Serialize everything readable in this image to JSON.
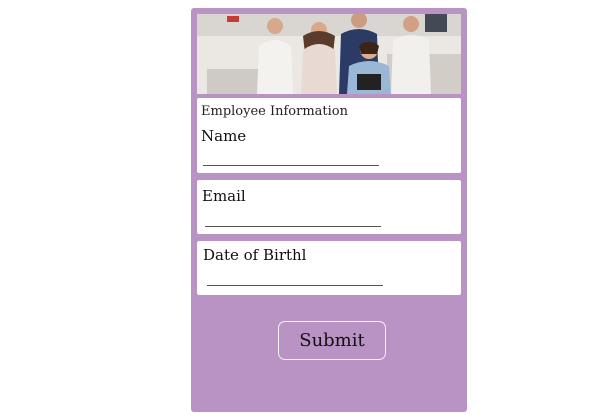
{
  "colors": {
    "panel_background": "#b893c3",
    "card_background": "#ffffff",
    "button_border": "#f4f4f4"
  },
  "banner": {
    "image": "team-photo"
  },
  "form": {
    "heading": "Employee Information",
    "fields": [
      {
        "label": "Name",
        "value": ""
      },
      {
        "label": "Email",
        "value": ""
      },
      {
        "label": "Date of Birthl",
        "value": ""
      }
    ],
    "submit_label": "Submit"
  }
}
